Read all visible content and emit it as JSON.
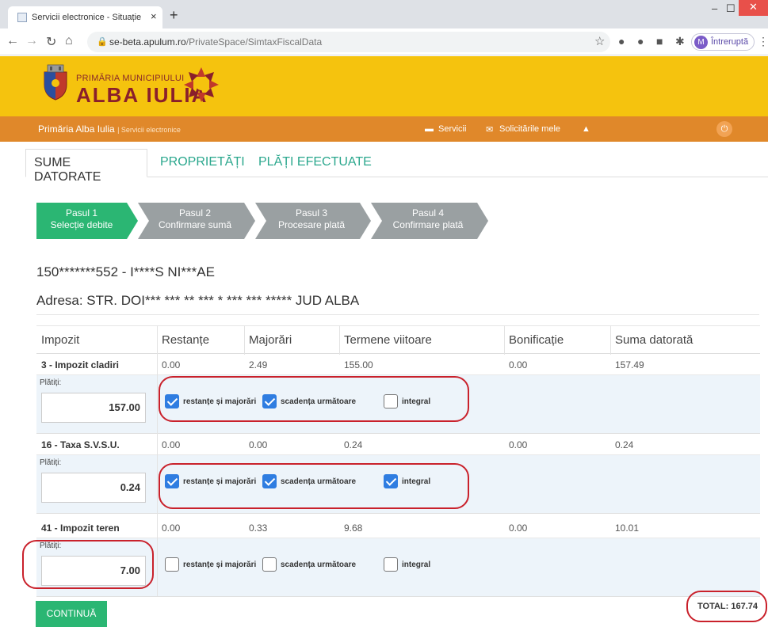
{
  "browser": {
    "tab_title": "Servicii electronice - Situație fisca",
    "new_tab": "+",
    "tab_close": "×",
    "url_host": "se-beta.apulum.ro",
    "url_path": "/PrivateSpace/SimtaxFiscalData",
    "profile_initial": "M",
    "profile_label": "Întreruptă"
  },
  "header": {
    "brand_small": "PRIMĂRIA MUNICIPIULUI",
    "brand_big": "ALBA IULIA"
  },
  "navbar": {
    "site_name": "Primăria Alba Iulia",
    "site_sub": "| Servicii electronice",
    "servicii": "Servicii",
    "solicitari": "Solicitările mele"
  },
  "tabs": {
    "sume": "SUME DATORATE",
    "proprietati": "PROPRIETĂȚI",
    "plati": "PLĂȚI EFECTUATE"
  },
  "steps": [
    {
      "title": "Pasul 1",
      "sub": "Selecție debite"
    },
    {
      "title": "Pasul 2",
      "sub": "Confirmare sumă"
    },
    {
      "title": "Pasul 3",
      "sub": "Procesare plată"
    },
    {
      "title": "Pasul 4",
      "sub": "Confirmare plată"
    }
  ],
  "taxpayer": "150*******552 - I****S NI***AE",
  "address": "Adresa: STR. DOI*** *** ** *** * *** *** ***** JUD ALBA",
  "table": {
    "headers": [
      "Impozit",
      "Restanțe",
      "Majorări",
      "Termene viitoare",
      "Bonificație",
      "Suma datorată"
    ],
    "pay_label": "Plătiți:",
    "opt_restante": "restanțe și majorări",
    "opt_scadenta": "scadența următoare",
    "opt_integral": "integral",
    "rows": [
      {
        "name": "3 - Impozit cladiri",
        "restante": "0.00",
        "majorari": "2.49",
        "termene": "155.00",
        "bonificatie": "0.00",
        "suma": "157.49",
        "pay": "157.00"
      },
      {
        "name": "16 - Taxa S.V.S.U.",
        "restante": "0.00",
        "majorari": "0.00",
        "termene": "0.24",
        "bonificatie": "0.00",
        "suma": "0.24",
        "pay": "0.24"
      },
      {
        "name": "41 - Impozit teren",
        "restante": "0.00",
        "majorari": "0.33",
        "termene": "9.68",
        "bonificatie": "0.00",
        "suma": "10.01",
        "pay": "7.00"
      }
    ]
  },
  "checkbox_states": [
    [
      true,
      true,
      false
    ],
    [
      true,
      true,
      true
    ],
    [
      false,
      false,
      false
    ]
  ],
  "continue_label": "CONTINUĂ",
  "total": "TOTAL: 167.74",
  "colors": {
    "accent_green": "#2bb673",
    "banner_yellow": "#f5c30e",
    "navbar_orange": "#e0882a",
    "annotation_red": "#c9212b",
    "checkbox_blue": "#2f7de1"
  }
}
